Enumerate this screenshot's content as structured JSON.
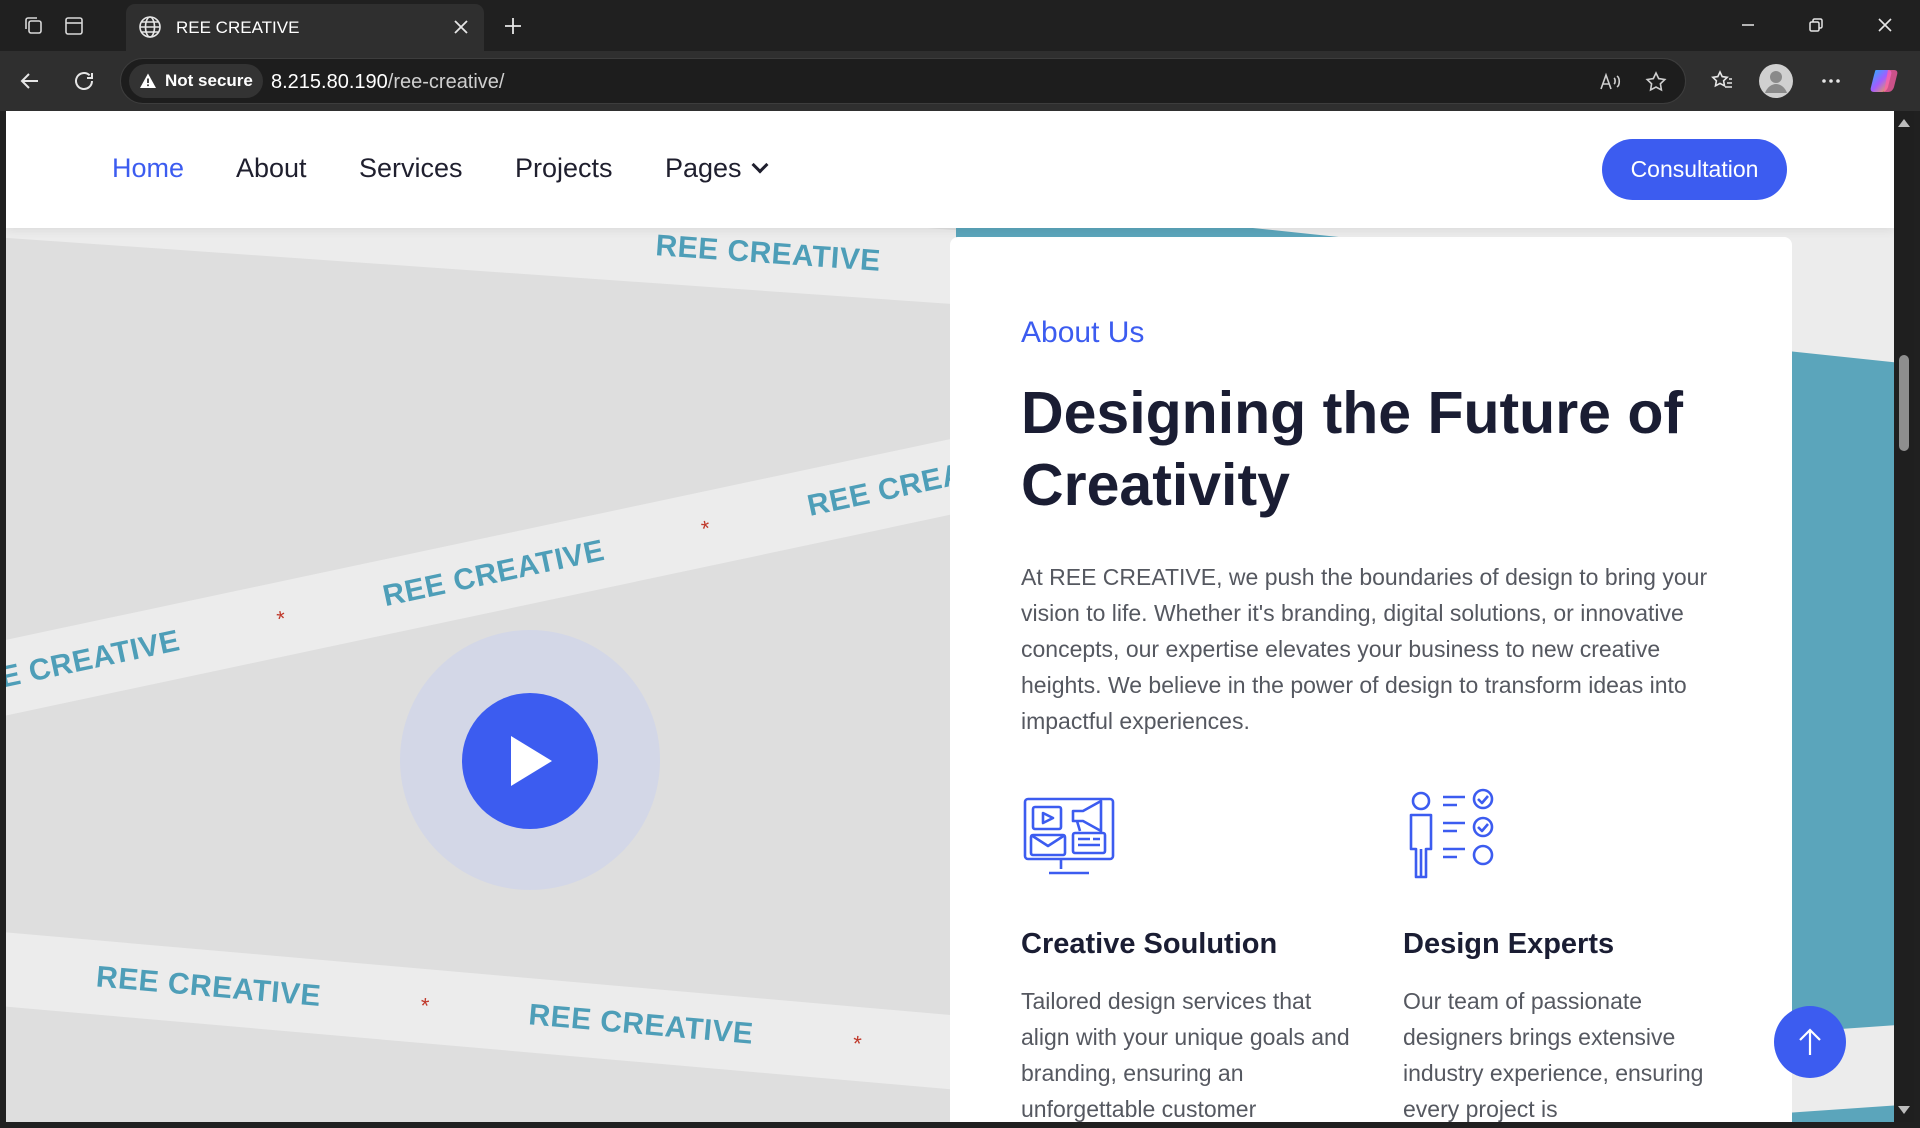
{
  "browser": {
    "tab_title": "REE CREATIVE",
    "security_label": "Not secure",
    "url_host": "8.215.80.190",
    "url_path": "/ree-creative/"
  },
  "site": {
    "nav": {
      "home": "Home",
      "about": "About",
      "services": "Services",
      "projects": "Projects",
      "pages": "Pages"
    },
    "cta_label": "Consultation",
    "ribbon_text": "REE CREATIVE",
    "ribbon_star": "*"
  },
  "about": {
    "kicker": "About Us",
    "title": "Designing the Future of Creativity",
    "text": "At REE CREATIVE, we push the boundaries of design to bring your vision to life. Whether it's branding, digital solutions, or innovative concepts, our expertise elevates your business to new creative heights. We believe in the power of design to transform ideas into impactful experiences.",
    "features": [
      {
        "title": "Creative Soulution",
        "text": "Tailored design services that align with your unique goals and branding, ensuring an unforgettable customer",
        "icon": "marketing-monitor-icon"
      },
      {
        "title": "Design Experts",
        "text": "Our team of passionate designers brings extensive industry experience, ensuring every project is",
        "icon": "expert-checklist-icon"
      }
    ]
  },
  "colors": {
    "accent": "#3c5cf0",
    "heading": "#1a1d33",
    "teal": "#5ba5bb",
    "ribbon_text": "#4e9eb8"
  }
}
